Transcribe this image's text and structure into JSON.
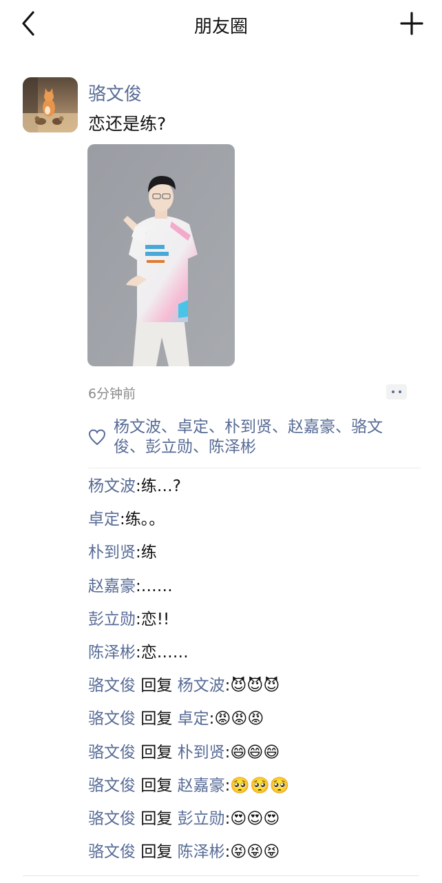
{
  "header": {
    "title": "朋友圈"
  },
  "post": {
    "author": "骆文俊",
    "text": "恋还是练?",
    "time": "6分钟前"
  },
  "likes": {
    "names": "杨文波、卓定、朴到贤、赵嘉豪、骆文俊、彭立勋、陈泽彬"
  },
  "comments": [
    {
      "name": "杨文波",
      "sep": ":",
      "text": "练…?"
    },
    {
      "name": "卓定",
      "sep": ":",
      "text": "练。。"
    },
    {
      "name": "朴到贤",
      "sep": ":",
      "text": "练"
    },
    {
      "name": "赵嘉豪",
      "sep": ":",
      "text": "……"
    },
    {
      "name": "彭立勋",
      "sep": ":",
      "text": "恋!!"
    },
    {
      "name": "陈泽彬",
      "sep": ":",
      "text": "恋……"
    },
    {
      "name": "骆文俊",
      "reply_word": "回复",
      "target": "杨文波",
      "sep": ":",
      "text": "😈😈😈"
    },
    {
      "name": "骆文俊",
      "reply_word": "回复",
      "target": "卓定",
      "sep": ":",
      "text": "😡😡😡"
    },
    {
      "name": "骆文俊",
      "reply_word": "回复",
      "target": "朴到贤",
      "sep": ":",
      "text": "😄😄😄"
    },
    {
      "name": "骆文俊",
      "reply_word": "回复",
      "target": "赵嘉豪",
      "sep": ":",
      "text": "🥺🥺🥺"
    },
    {
      "name": "骆文俊",
      "reply_word": "回复",
      "target": "彭立勋",
      "sep": ":",
      "text": "😍😍😍"
    },
    {
      "name": "骆文俊",
      "reply_word": "回复",
      "target": "陈泽彬",
      "sep": ":",
      "text": "😝😝😝"
    }
  ],
  "icons": {
    "back": "chevron-left-icon",
    "add": "plus-icon",
    "like": "heart-outline-icon",
    "more": "more-dots-icon"
  },
  "colors": {
    "name_link": "#576b95",
    "text": "#111111",
    "muted": "#8a8a8a"
  }
}
